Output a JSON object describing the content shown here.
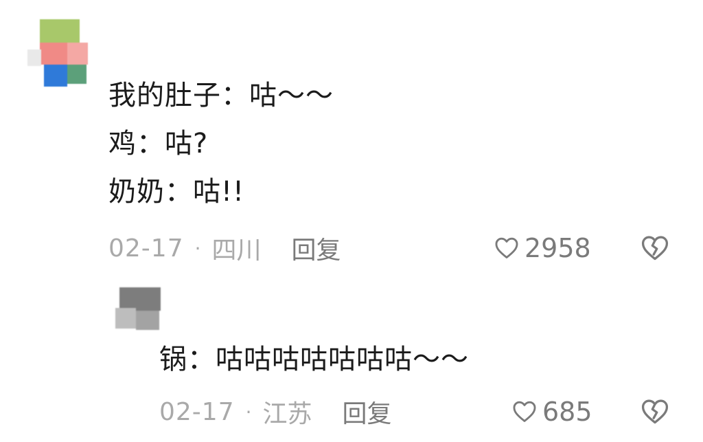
{
  "comment": {
    "lines": [
      "我的肚子：咕～～",
      "鸡：咕?",
      "奶奶：咕!!"
    ],
    "date": "02-17",
    "separator": "·",
    "location": "四川",
    "reply_label": "回复",
    "likes": "2958",
    "avatar_colors": [
      "#a8c86a",
      "#f08a86",
      "#f4a8a4",
      "#2f7ad9",
      "#5ca07a",
      "#e6e6e6"
    ]
  },
  "reply": {
    "text": "锅：咕咕咕咕咕咕咕～～",
    "date": "02-17",
    "separator": "·",
    "location": "江苏",
    "reply_label": "回复",
    "likes": "685",
    "avatar_colors": [
      "#7d7d7d",
      "#a3a3a3",
      "#c9c9c9"
    ]
  },
  "icons": {
    "like": "heart-outline-icon",
    "dislike": "broken-heart-icon"
  },
  "colors": {
    "text": "#1b1b1b",
    "meta": "#a9a9a9",
    "action": "#7a7a7a"
  }
}
